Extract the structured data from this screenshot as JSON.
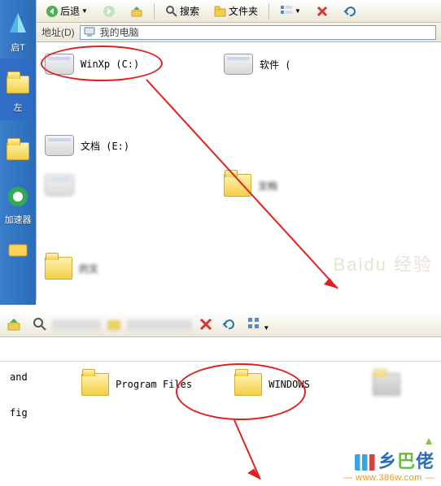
{
  "top": {
    "toolbar": {
      "back_label": "后退",
      "search_label": "搜索",
      "folders_label": "文件夹"
    },
    "address": {
      "label": "地址(D)",
      "value": "我的电脑"
    },
    "drives": [
      {
        "label": "WinXp (C:)"
      },
      {
        "label": "软件 ("
      },
      {
        "label": "文档 (E:)"
      }
    ],
    "row2": [
      {
        "label": ""
      },
      {
        "label": "文档"
      },
      {
        "label": "的文"
      }
    ],
    "desktop": {
      "item1": "启T",
      "item2": "左",
      "item3": "加速器",
      "item4": ""
    },
    "watermark": "Baidu 经验"
  },
  "bottom": {
    "side": {
      "t1": "and",
      "t2": "fig"
    },
    "folders": [
      {
        "label": "Program Files"
      },
      {
        "label": "WINDOWS"
      }
    ],
    "brand": {
      "cn1": "乡",
      "cn2": "巴",
      "cn3": "佬",
      "url": "www.386w.com"
    }
  }
}
